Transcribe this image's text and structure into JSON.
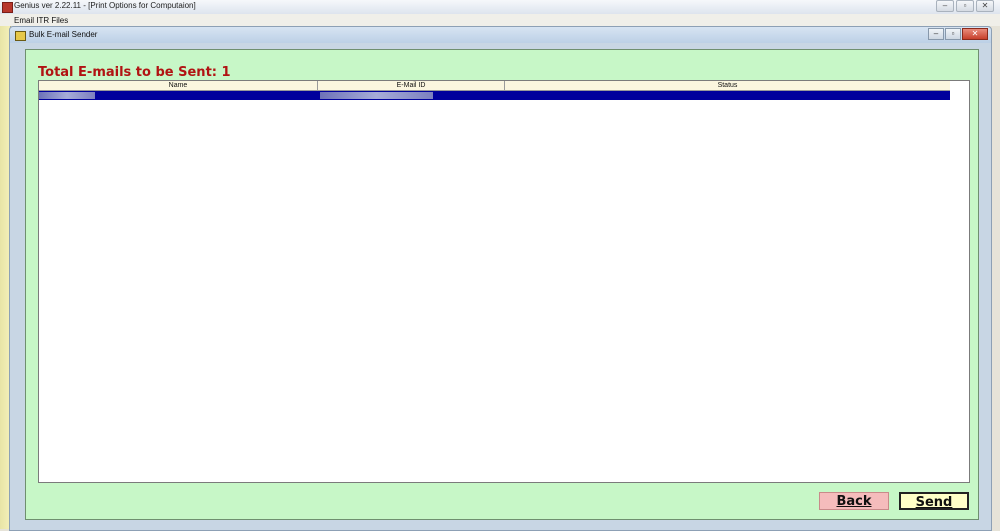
{
  "app": {
    "title": "Genius ver 2.22.11 - [Print Options for Computaion]",
    "menu_item": "Email ITR Files",
    "controls": {
      "minimize": "–",
      "restore": "▫",
      "close": "✕"
    }
  },
  "window": {
    "title": "Bulk E-mail Sender",
    "controls": {
      "minimize": "–",
      "restore": "▫",
      "close": "✕"
    }
  },
  "form": {
    "total_label": "Total E-mails to be Sent: 1",
    "columns": [
      "Name",
      "E-Mail ID",
      "Status"
    ],
    "back_label": "Back",
    "send_label": "Send"
  },
  "colors": {
    "form_bg": "#c7f7c7",
    "heading": "#b11313",
    "selected_row": "#00009c",
    "back_button": "#f5bcbc",
    "send_button": "#ffffc8"
  }
}
